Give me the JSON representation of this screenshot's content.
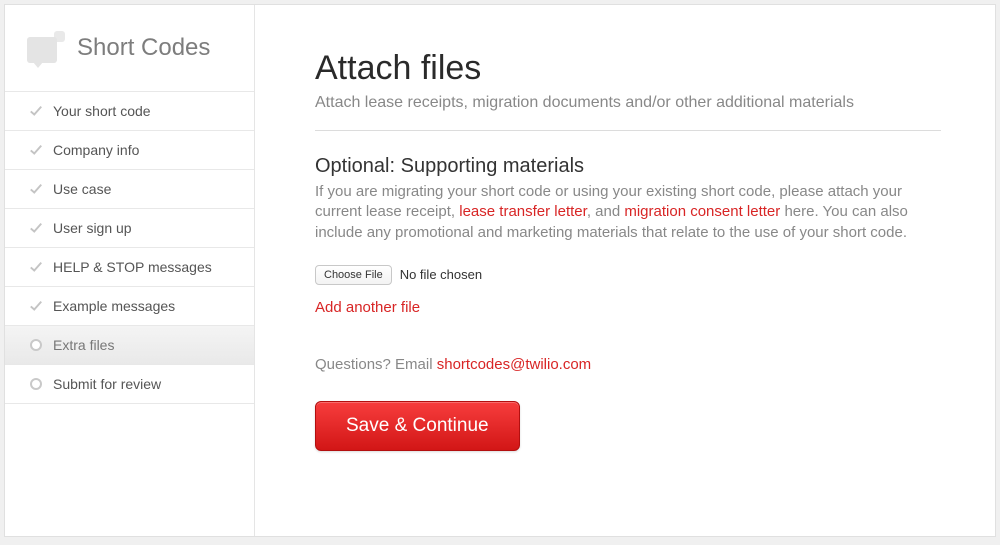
{
  "sidebar": {
    "title": "Short Codes",
    "items": [
      {
        "label": "Your short code",
        "state": "done"
      },
      {
        "label": "Company info",
        "state": "done"
      },
      {
        "label": "Use case",
        "state": "done"
      },
      {
        "label": "User sign up",
        "state": "done"
      },
      {
        "label": "HELP & STOP messages",
        "state": "done"
      },
      {
        "label": "Example messages",
        "state": "done"
      },
      {
        "label": "Extra files",
        "state": "active"
      },
      {
        "label": "Submit for review",
        "state": "todo"
      }
    ]
  },
  "main": {
    "title": "Attach files",
    "subtitle": "Attach lease receipts, migration documents and/or other additional materials",
    "section_title": "Optional: Supporting materials",
    "body": {
      "pre": "If you are migrating your short code or using your existing short code, please attach your current lease receipt, ",
      "link1": "lease transfer letter",
      "mid": ", and ",
      "link2": "migration consent letter",
      "post": " here. You can also include any promotional and marketing materials that relate to the use of your short code."
    },
    "file": {
      "choose_label": "Choose File",
      "status": "No file chosen"
    },
    "add_another": "Add another file",
    "questions": {
      "prefix": "Questions? Email ",
      "email": "shortcodes@twilio.com"
    },
    "primary": "Save & Continue"
  }
}
